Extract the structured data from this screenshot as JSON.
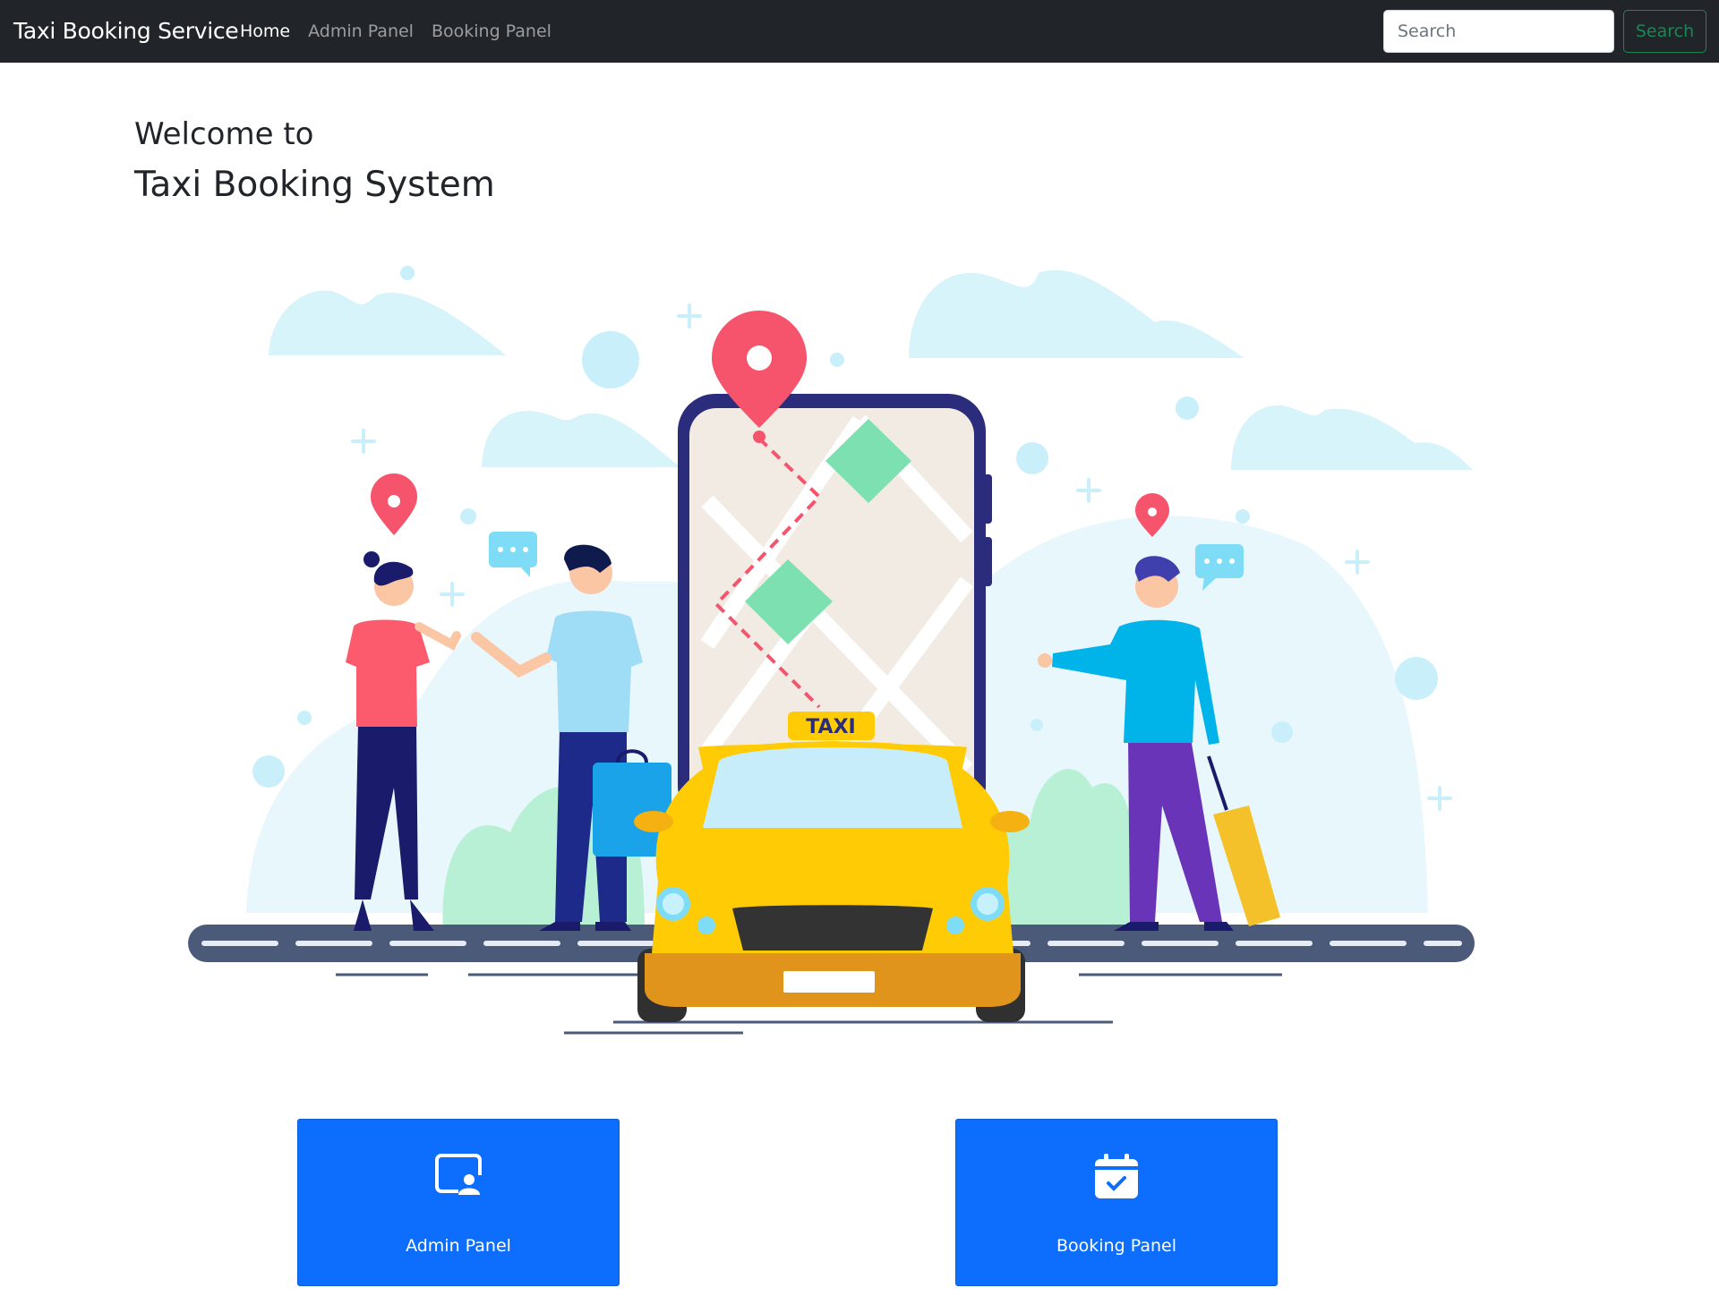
{
  "navbar": {
    "brand": "Taxi Booking Service",
    "links": [
      {
        "label": "Home",
        "active": true
      },
      {
        "label": "Admin Panel",
        "active": false
      },
      {
        "label": "Booking Panel",
        "active": false
      }
    ],
    "search_placeholder": "Search",
    "search_button": "Search"
  },
  "hero": {
    "line1": "Welcome to",
    "line2": "Taxi Booking System",
    "illustration_sign": "TAXI"
  },
  "cards": [
    {
      "label": "Admin Panel",
      "icon": "person-video-icon"
    },
    {
      "label": "Booking Panel",
      "icon": "calendar-check-icon"
    }
  ],
  "colors": {
    "navbar_bg": "#212529",
    "primary": "#0d6efd",
    "success": "#198754",
    "taxi_yellow": "#ffcb05",
    "pin_red": "#f5546c"
  }
}
